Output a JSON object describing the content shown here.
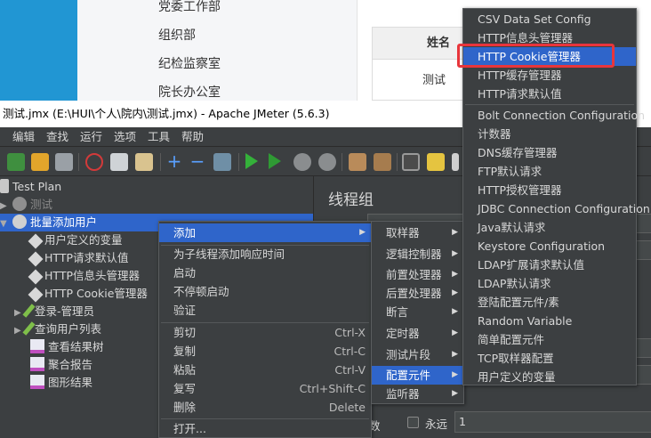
{
  "background_page": {
    "departments": [
      "党委工作部",
      "组织部",
      "纪检监察室",
      "院长办公室"
    ],
    "table_header": "姓名",
    "table_cell": "测试"
  },
  "window": {
    "title": "测试.jmx (E:\\HUI\\个人\\院内\\测试.jmx) - Apache JMeter (5.6.3)"
  },
  "menubar": [
    "编辑",
    "查找",
    "运行",
    "选项",
    "工具",
    "帮助"
  ],
  "tree": {
    "items": [
      {
        "label": "Test Plan",
        "icon": "flask-icon"
      },
      {
        "label": "测试",
        "icon": "gear-icon"
      },
      {
        "label": "批量添加用户",
        "icon": "gear-icon"
      },
      {
        "label": "用户定义的变量",
        "icon": "wrench-icon"
      },
      {
        "label": "HTTP请求默认值",
        "icon": "wrench-icon"
      },
      {
        "label": "HTTP信息头管理器",
        "icon": "wrench-icon"
      },
      {
        "label": "HTTP Cookie管理器",
        "icon": "wrench-icon"
      },
      {
        "label": "登录-管理员",
        "icon": "pipette-icon"
      },
      {
        "label": "查询用户列表",
        "icon": "pipette-icon"
      },
      {
        "label": "查看结果树",
        "icon": "chart-icon"
      },
      {
        "label": "聚合报告",
        "icon": "chart-icon"
      },
      {
        "label": "图形结果",
        "icon": "chart-icon"
      }
    ]
  },
  "panel": {
    "title": "线程组",
    "label_cut": "数",
    "forever_label": "永远",
    "loop_value": "1"
  },
  "context_menu": {
    "items": [
      {
        "label": "添加",
        "shortcut": "",
        "submenu": true
      },
      {
        "label": "为子线程添加响应时间",
        "shortcut": ""
      },
      {
        "label": "启动",
        "shortcut": ""
      },
      {
        "label": "不停顿启动",
        "shortcut": ""
      },
      {
        "label": "验证",
        "shortcut": ""
      },
      {
        "label": "剪切",
        "shortcut": "Ctrl-X"
      },
      {
        "label": "复制",
        "shortcut": "Ctrl-C"
      },
      {
        "label": "粘贴",
        "shortcut": "Ctrl-V"
      },
      {
        "label": "复写",
        "shortcut": "Ctrl+Shift-C"
      },
      {
        "label": "删除",
        "shortcut": "Delete"
      },
      {
        "label": "打开...",
        "shortcut": ""
      }
    ]
  },
  "add_submenu": {
    "items": [
      "取样器",
      "逻辑控制器",
      "前置处理器",
      "后置处理器",
      "断言",
      "定时器",
      "测试片段",
      "配置元件",
      "监听器"
    ]
  },
  "config_submenu": {
    "items": [
      "CSV Data Set Config",
      "HTTP信息头管理器",
      "HTTP Cookie管理器",
      "HTTP缓存管理器",
      "HTTP请求默认值",
      "Bolt Connection Configuration",
      "计数器",
      "DNS缓存管理器",
      "FTP默认请求",
      "HTTP授权管理器",
      "JDBC Connection Configuration",
      "Java默认请求",
      "Keystore Configuration",
      "LDAP扩展请求默认值",
      "LDAP默认请求",
      "登陆配置元件/素",
      "Random Variable",
      "简单配置元件",
      "TCP取样器配置",
      "用户定义的变量"
    ]
  },
  "colors": {
    "selection": "#2f65ca",
    "highlight_box": "#e8353b"
  }
}
